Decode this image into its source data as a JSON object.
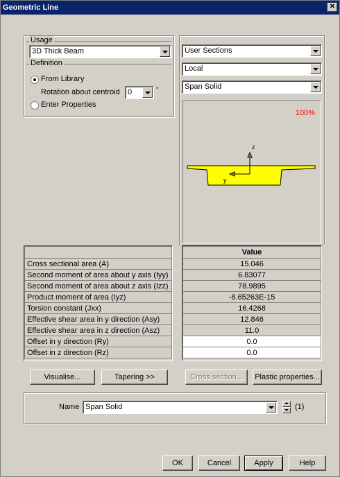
{
  "window": {
    "title": "Geometric Line",
    "close_glyph": "✕"
  },
  "usage": {
    "legend": "Usage",
    "selected": "3D Thick Beam"
  },
  "definition": {
    "legend": "Definition",
    "from_library": "From Library",
    "rotation_label": "Rotation about centroid",
    "rotation_value": "0",
    "rotation_unit": "°",
    "enter_properties": "Enter Properties"
  },
  "right_combos": {
    "source": "User Sections",
    "axis": "Local",
    "section": "Span Solid"
  },
  "preview": {
    "zoom": "100%",
    "axis_z": "z",
    "axis_y": "y",
    "shape_color": "#ffff00"
  },
  "table": {
    "value_header": "Value",
    "rows": [
      {
        "label": "Cross sectional area (A)",
        "value": "15.046",
        "editable": false
      },
      {
        "label": "Second moment of area about y axis (Iyy)",
        "value": "6.83077",
        "editable": false
      },
      {
        "label": "Second moment of area about z axis (Izz)",
        "value": "78.9895",
        "editable": false
      },
      {
        "label": "Product moment of area (Iyz)",
        "value": "-8.65263E-15",
        "editable": false
      },
      {
        "label": "Torsion constant (Jxx)",
        "value": "16.4268",
        "editable": false
      },
      {
        "label": "Effective shear area in y direction (Asy)",
        "value": "12.846",
        "editable": false
      },
      {
        "label": "Effective shear area in z direction (Asz)",
        "value": "11.0",
        "editable": false
      },
      {
        "label": "Offset in y direction (Ry)",
        "value": "0.0",
        "editable": true
      },
      {
        "label": "Offset in z direction (Rz)",
        "value": "0.0",
        "editable": true
      }
    ]
  },
  "buttons": {
    "visualise": "Visualise...",
    "tapering": "Tapering >>",
    "cross_section": "Cross section...",
    "plastic": "Plastic properties...",
    "ok": "OK",
    "cancel": "Cancel",
    "apply": "Apply",
    "help": "Help"
  },
  "name": {
    "label": "Name",
    "value": "Span Solid",
    "count": "(1)"
  }
}
